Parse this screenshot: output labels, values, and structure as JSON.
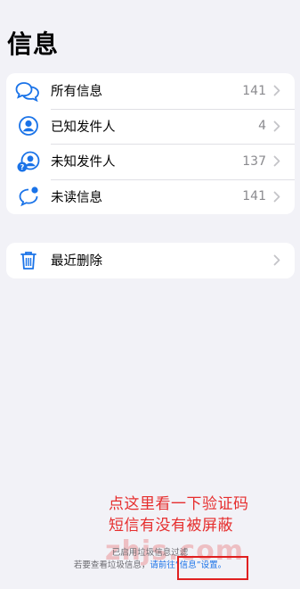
{
  "page": {
    "title": "信息"
  },
  "filters": [
    {
      "icon": "chat-bubbles-icon",
      "label": "所有信息",
      "count": "141"
    },
    {
      "icon": "known-person-icon",
      "label": "已知发件人",
      "count": "4"
    },
    {
      "icon": "unknown-person-icon",
      "label": "未知发件人",
      "count": "137"
    },
    {
      "icon": "unread-bubble-icon",
      "label": "未读信息",
      "count": "141"
    }
  ],
  "recently_deleted": {
    "icon": "trash-icon",
    "label": "最近删除"
  },
  "footer": {
    "line1": "已启用垃圾信息过滤",
    "line2_prefix": "若要查看垃圾信息，",
    "line2_link": "请前往“信息”设置。"
  },
  "annotation": {
    "line1": "点这里看一下验证码",
    "line2": "短信有没有被屏蔽"
  },
  "watermark": "zhjs.com",
  "colors": {
    "accent": "#1a73e8",
    "annotation": "#e62e2e",
    "background": "#f2f2f7"
  }
}
